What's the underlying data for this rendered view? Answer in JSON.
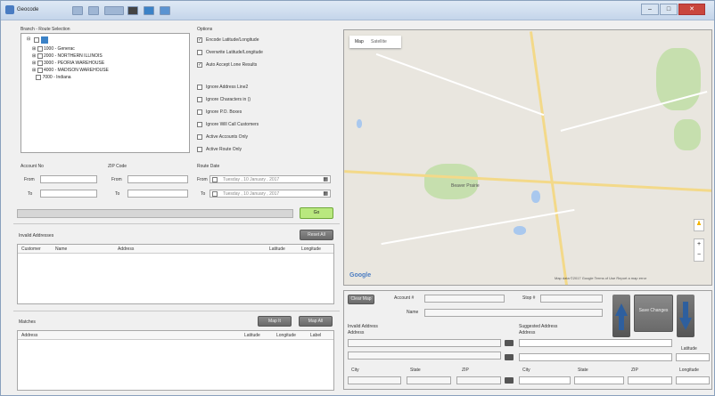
{
  "window": {
    "title": "Geocode",
    "min_label": "–",
    "max_label": "□",
    "close_label": "✕"
  },
  "branch_route": {
    "title": "Branch - Route Selection",
    "tree": [
      {
        "label": "1000 - Generac"
      },
      {
        "label": "2000 - NORTHERN ILLINOIS"
      },
      {
        "label": "3000 - PEORIA WAREHOUSE"
      },
      {
        "label": "4000 - MADISON WAREHOUSE"
      },
      {
        "label": "7000 - Indiana"
      }
    ]
  },
  "options": {
    "title": "Options",
    "items": [
      {
        "label": "Encode Latitude/Longitude",
        "checked": true
      },
      {
        "label": "Overwrite Latitude/Longitude",
        "checked": false
      },
      {
        "label": "Auto Accept Lone Results",
        "checked": true
      },
      {
        "label": "Ignore Address Line2",
        "checked": false
      },
      {
        "label": "Ignore Characters in ()",
        "checked": false
      },
      {
        "label": "Ignore P.O. Boxes",
        "checked": false
      },
      {
        "label": "Ignore Will Call Customers",
        "checked": false
      },
      {
        "label": "Active Accounts Only",
        "checked": false
      },
      {
        "label": "Active Route Only",
        "checked": false
      }
    ]
  },
  "account_no": {
    "title": "Account No",
    "from": "From",
    "to": "To"
  },
  "zip_code": {
    "title": "ZIP Code",
    "from": "From",
    "to": "To"
  },
  "route_date": {
    "title": "Route Date",
    "from": "From",
    "to": "To",
    "from_value": "Tuesday , 10 January , 2017",
    "to_value": "Tuesday , 10 January , 2017"
  },
  "go_button": "Go",
  "invalid": {
    "title": "Invalid Addresses",
    "button": "Reset All",
    "columns": [
      "Customer",
      "Name",
      "Address",
      "Latitude",
      "Longitude"
    ]
  },
  "matches": {
    "title": "Matches",
    "btn1": "Map It",
    "btn2": "Map All",
    "columns": [
      "Address",
      "Latitude",
      "Longitude",
      "Label"
    ]
  },
  "map": {
    "tab_map": "Map",
    "tab_satellite": "Satellite",
    "town": "Beaver Prairie",
    "logo": "Google",
    "footer": "Map data ©2017 Google   Terms of Use   Report a map error",
    "zoom_in": "+",
    "zoom_out": "−"
  },
  "detail": {
    "clear_map": "Clear Map",
    "account": "Account #",
    "stop": "Stop #",
    "name": "Name",
    "invalid_address": "Invalid Address",
    "address1": "Address",
    "suggested": "Suggested Address",
    "address2": "Address",
    "latitude": "Latitude",
    "city": "City",
    "state": "State",
    "zip": "ZIP",
    "city2": "City",
    "state2": "State",
    "zip2": "ZIP",
    "longitude": "Longitude",
    "save_button": "Save Changes"
  },
  "colors": {
    "title_bar": "#c4d5ea",
    "go_button": "#b9e87f",
    "arrow_blue": "#2e5f9e"
  }
}
